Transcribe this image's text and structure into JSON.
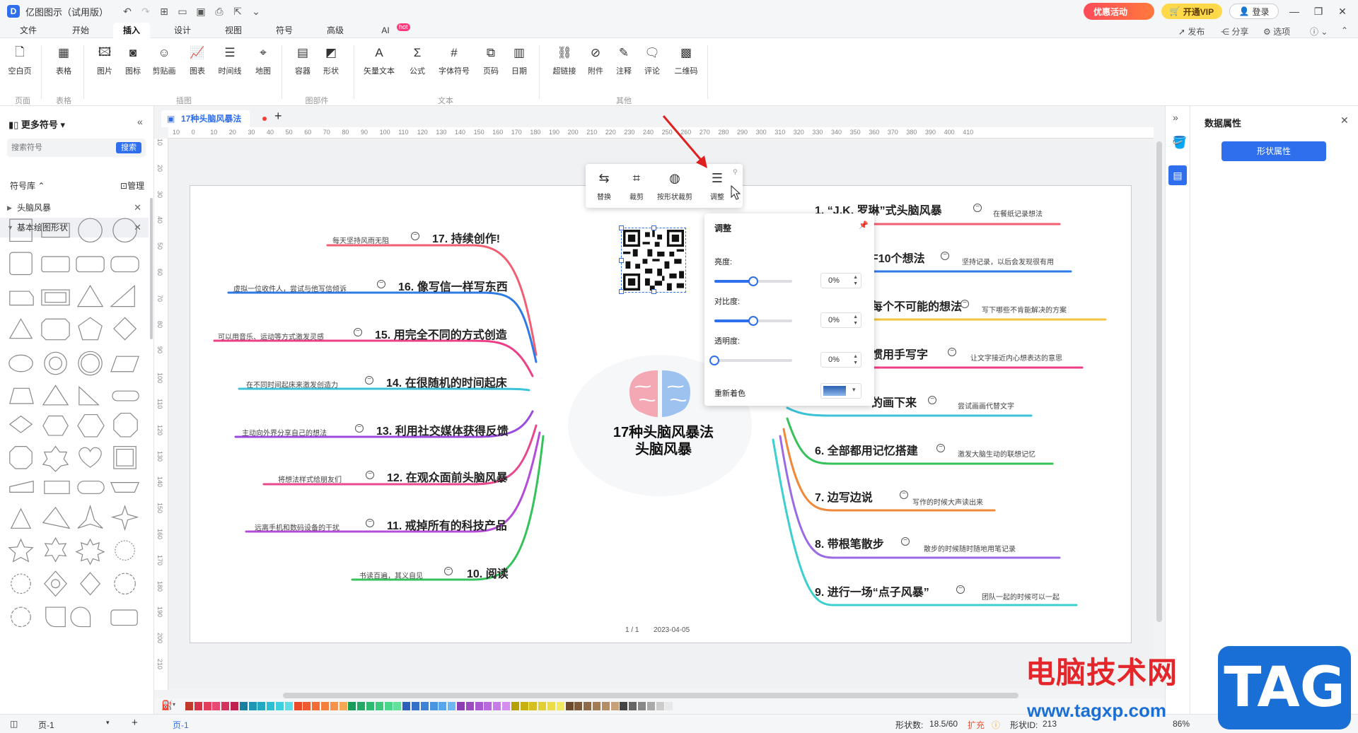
{
  "app": {
    "title": "亿图图示（试用版）",
    "promo_label": "优惠活动",
    "vip_label": "开通VIP",
    "login_label": "登录"
  },
  "menus": [
    "文件",
    "开始",
    "插入",
    "设计",
    "视图",
    "符号",
    "高级",
    "AI"
  ],
  "menu_active": "插入",
  "ai_badge": "hot",
  "right_links": [
    "发布",
    "分享",
    "选项"
  ],
  "ribbon": {
    "buttons": [
      "空白页",
      "表格",
      "图片",
      "图标",
      "剪贴画",
      "图表",
      "时间线",
      "地图",
      "容器",
      "形状",
      "矢量文本",
      "公式",
      "字体符号",
      "页码",
      "日期",
      "超链接",
      "附件",
      "注释",
      "评论",
      "二维码"
    ],
    "groups": [
      "页面",
      "表格",
      "插图",
      "图部件",
      "文本",
      "其他"
    ]
  },
  "left_panel": {
    "title": "更多符号",
    "search_placeholder": "搜索符号",
    "search_button": "搜索",
    "library_label": "符号库",
    "manage_label": "管理",
    "libraries": [
      "头脑风暴",
      "基本绘图形状"
    ]
  },
  "document_tab": "17种头脑风暴法",
  "ruler_h": [
    "10",
    "0",
    "10",
    "20",
    "30",
    "40",
    "50",
    "60",
    "70",
    "80",
    "90",
    "100",
    "110",
    "120",
    "130",
    "140",
    "150",
    "160",
    "170",
    "180",
    "190",
    "200",
    "210",
    "220",
    "230",
    "240",
    "250",
    "260",
    "270",
    "280",
    "290",
    "300",
    "310",
    "320",
    "330",
    "340",
    "350",
    "360",
    "370",
    "380",
    "390",
    "400",
    "410"
  ],
  "ruler_v": [
    "10",
    "20",
    "30",
    "40",
    "50",
    "60",
    "70",
    "80",
    "90",
    "100",
    "110",
    "120",
    "130",
    "140",
    "150",
    "160",
    "170",
    "180",
    "190",
    "200",
    "210"
  ],
  "mindmap": {
    "center": "17种头脑风暴法\n头脑风暴",
    "left_topics": [
      {
        "title": "17. 持续创作!",
        "note": "每天坚持风雨无阻"
      },
      {
        "title": "16. 像写信一样写东西",
        "note": "虚拟一位收件人，尝试与他写信倾诉"
      },
      {
        "title": "15. 用完全不同的方式创造",
        "note": "可以用音乐、运动等方式激发灵感"
      },
      {
        "title": "14. 在很随机的时间起床",
        "note": "在不同时间起床来激发创造力"
      },
      {
        "title": "13. 利用社交媒体获得反馈",
        "note": "主动向外界分享自己的想法"
      },
      {
        "title": "12. 在观众面前头脑风暴",
        "note": "将想法样式给朋友们"
      },
      {
        "title": "11. 戒掉所有的科技产品",
        "note": "远离手机和数码设备的干扰"
      },
      {
        "title": "10. 阅读",
        "note": "书读百遍，其义自见"
      }
    ],
    "right_topics": [
      {
        "title": "1. “J.K. 罗琳”式头脑风暴",
        "note": "在餐纸记录想法"
      },
      {
        "title": "F10个想法",
        "note": "坚持记录，以后会发现很有用"
      },
      {
        "title": "每个不可能的想法",
        "note": "写下哪些不肯能解决的方案"
      },
      {
        "title": "惯用手写字",
        "note": "让文字接近内心想表达的意思"
      },
      {
        "title": "的画下来",
        "note": "尝试画画代替文字"
      },
      {
        "title": "6. 全部都用记忆搭建",
        "note": "激发大脑生动的联想记忆"
      },
      {
        "title": "7. 边写边说",
        "note": "写作的时候大声读出来"
      },
      {
        "title": "8. 带根笔散步",
        "note": "散步的时候随时随地用笔记录"
      },
      {
        "title": "9. 进行一场“点子风暴”",
        "note": "团队一起的时候可以一起"
      }
    ],
    "page_number": "1 / 1",
    "page_date": "2023-04-05"
  },
  "image_toolbar": [
    "替换",
    "裁剪",
    "按形状裁剪",
    "调整"
  ],
  "adjust_panel": {
    "title": "调整",
    "brightness_label": "亮度:",
    "brightness_value": "0%",
    "brightness_level": 0.5,
    "contrast_label": "对比度:",
    "contrast_value": "0%",
    "contrast_level": 0.5,
    "transparency_label": "透明度:",
    "transparency_value": "0%",
    "transparency_level": 0,
    "recolor_label": "重新着色"
  },
  "right_panel": {
    "title": "数据属性",
    "shape_button": "形状属性"
  },
  "palette": [
    "#c0392b",
    "#d6334a",
    "#e23d5d",
    "#e84a73",
    "#d5335e",
    "#bf2050",
    "#1a7fa0",
    "#1f96b4",
    "#23a8c2",
    "#2bbfd4",
    "#3dd0de",
    "#5fdde6",
    "#e84a2a",
    "#ef5a30",
    "#f26d36",
    "#f47f3e",
    "#f79248",
    "#f9a752",
    "#1a9a5a",
    "#22aa64",
    "#2cba70",
    "#3ac97d",
    "#4ad78b",
    "#62e09c",
    "#2c5fb8",
    "#3470c8",
    "#3d82d6",
    "#4a94e2",
    "#5aa6ec",
    "#6fb7f2",
    "#8c3fb0",
    "#9b4cc0",
    "#aa5ad0",
    "#b86adc",
    "#c67be6",
    "#d48eee",
    "#b8a000",
    "#c8b010",
    "#d6c020",
    "#e2cf34",
    "#ecdc4a",
    "#f3e862",
    "#6b4a2e",
    "#7d5a3a",
    "#8f6a46",
    "#a27c54",
    "#b48e64",
    "#c6a078",
    "#444444",
    "#666666",
    "#888888",
    "#aaaaaa",
    "#cccccc",
    "#e8e8e8"
  ],
  "status": {
    "page_select": "页-1",
    "page_tab": "页-1",
    "shape_count_label": "形状数:",
    "shape_count_value": "18.5/60",
    "expand_label": "扩充",
    "shape_id_label": "形状ID:",
    "shape_id_value": "213",
    "zoom": "86%"
  },
  "watermark": {
    "text": "电脑技术网",
    "url": "www.tagxp.com",
    "tag": "TAG"
  }
}
